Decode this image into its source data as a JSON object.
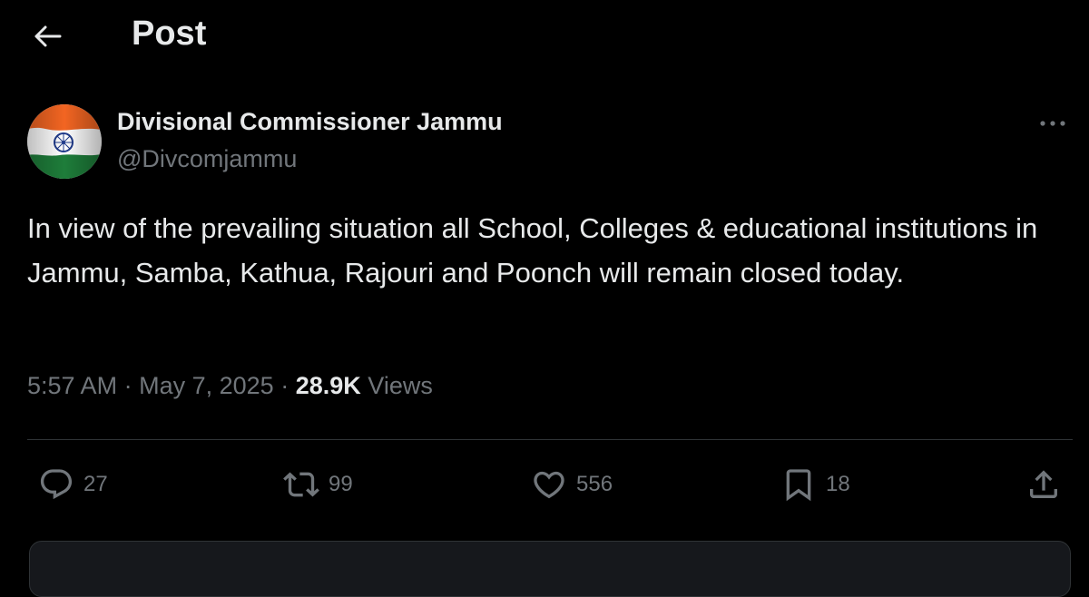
{
  "header": {
    "title": "Post",
    "back_icon": "arrow-left-icon"
  },
  "author": {
    "name": "Divisional Commissioner Jammu",
    "handle": "@Divcomjammu",
    "avatar": "india-flag-avatar"
  },
  "post": {
    "text": "In view of the prevailing situation all School, Colleges & educational institutions in Jammu, Samba, Kathua, Rajouri and Poonch will remain closed today.",
    "time": "5:57 AM",
    "separator": "·",
    "date": "May 7, 2025",
    "views_count": "28.9K",
    "views_label": "Views"
  },
  "actions": {
    "reply": {
      "icon": "reply-icon",
      "count": "27"
    },
    "repost": {
      "icon": "repost-icon",
      "count": "99"
    },
    "like": {
      "icon": "heart-icon",
      "count": "556"
    },
    "bookmark": {
      "icon": "bookmark-icon",
      "count": "18"
    },
    "share": {
      "icon": "share-icon"
    }
  },
  "colors": {
    "background": "#000000",
    "primary_text": "#e7e9ea",
    "secondary_text": "#71767b",
    "divider": "#2f3336"
  }
}
